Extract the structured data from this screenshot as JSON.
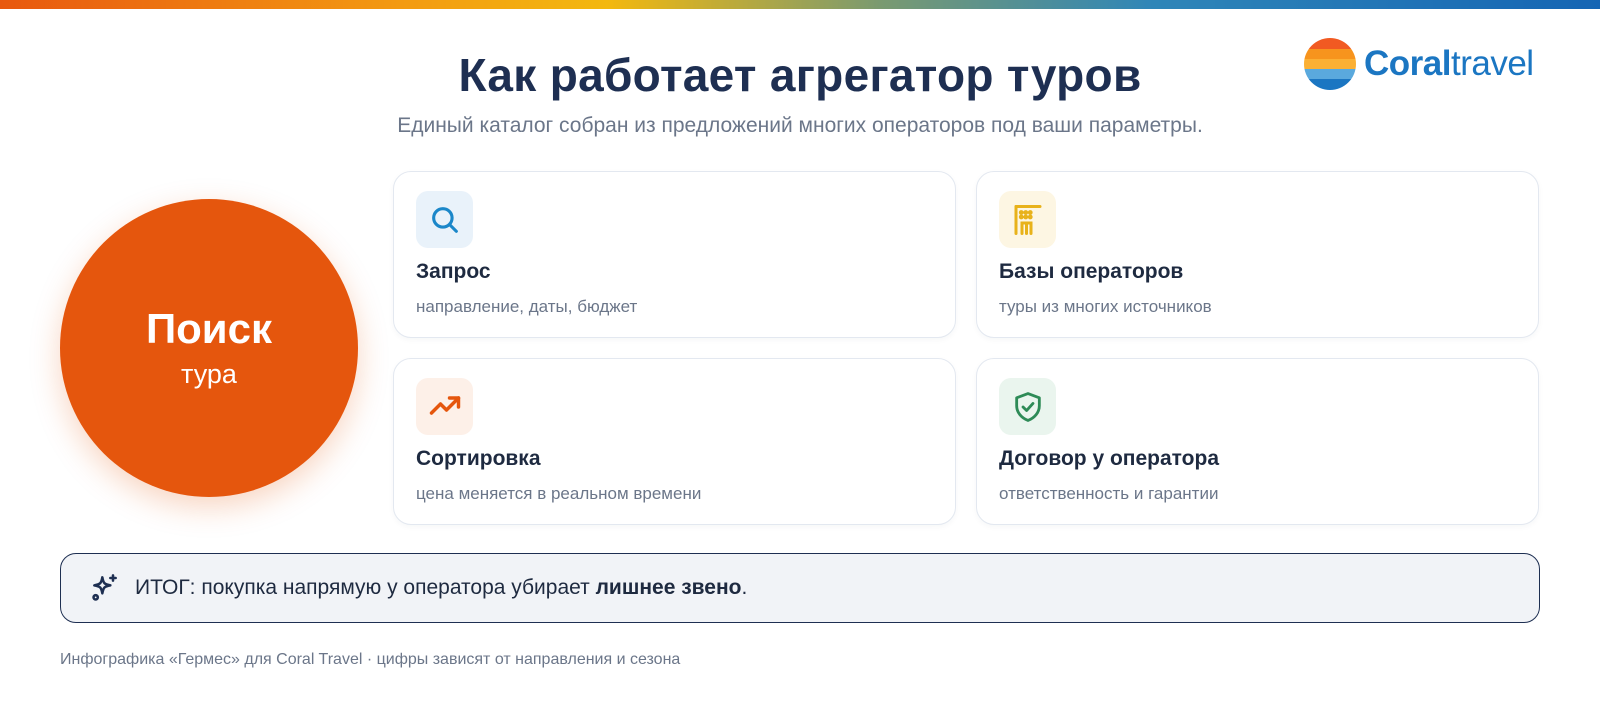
{
  "brand": {
    "text_bold": "Coral",
    "text_light": "travel",
    "stripe_colors": [
      "#f15a22",
      "#f7941d",
      "#fbb034",
      "#5aa9dd",
      "#1b76c2"
    ]
  },
  "header": {
    "title": "Как работает агрегатор туров",
    "subtitle": "Единый каталог собран из предложений многих операторов под ваши параметры."
  },
  "hub": {
    "title": "Поиск",
    "subtitle": "тура",
    "color": "#e5560d"
  },
  "cards": [
    {
      "title": "Запрос",
      "desc": "направление, даты, бюджет",
      "icon": "search-icon",
      "icon_color": "#1b87c9",
      "icon_bg": "#e9f2fa"
    },
    {
      "title": "Базы операторов",
      "desc": "туры из многих источников",
      "icon": "building-icon",
      "icon_color": "#e8b21a",
      "icon_bg": "#fdf6e3"
    },
    {
      "title": "Сортировка",
      "desc": "цена меняется в реальном времени",
      "icon": "trending-up-icon",
      "icon_color": "#e5560d",
      "icon_bg": "#fdf0e8"
    },
    {
      "title": "Договор у оператора",
      "desc": "ответственность и гарантии",
      "icon": "shield-check-icon",
      "icon_color": "#2e8b57",
      "icon_bg": "#eaf5ee"
    }
  ],
  "summary": {
    "text_before": "ИТОГ: покупка напрямую у оператора убирает ",
    "text_bold": "лишнее звено",
    "text_after": ".",
    "icon": "sparkles-icon"
  },
  "footer": {
    "text": "Инфографика «Гермес» для Coral Travel · цифры зависят от направления и сезона"
  }
}
